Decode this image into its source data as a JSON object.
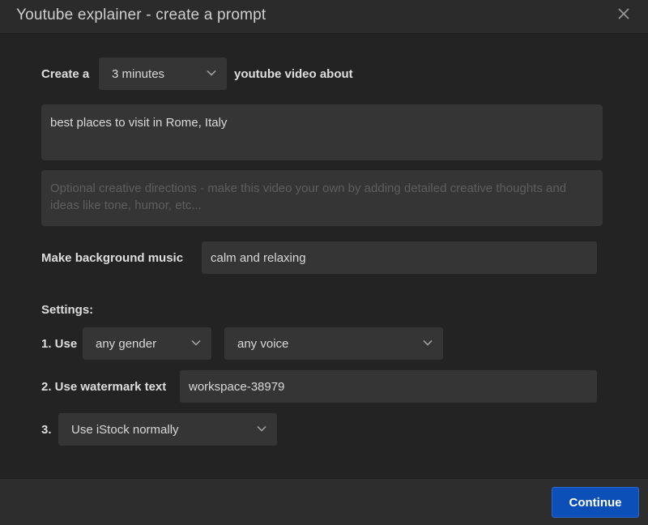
{
  "dialog": {
    "title": "Youtube explainer - create a prompt"
  },
  "prompt": {
    "create_label": "Create a",
    "duration": "3 minutes",
    "suffix_label": "youtube video about",
    "topic": "best places to visit in Rome, Italy",
    "creative_placeholder": "Optional creative directions - make this video your own by adding detailed creative thoughts and ideas like tone, humor, etc..."
  },
  "music": {
    "label": "Make background music",
    "value": "calm and relaxing"
  },
  "settings": {
    "heading": "Settings:",
    "use_label": "1. Use",
    "gender": "any gender",
    "voice": "any voice",
    "watermark_label": "2. Use watermark text",
    "watermark_value": "workspace-38979",
    "stock_label": "3.",
    "stock_option": "Use iStock normally"
  },
  "footer": {
    "continue_label": "Continue"
  },
  "colors": {
    "accent": "#0c4fb8",
    "background": "#232323",
    "field": "#353535"
  }
}
